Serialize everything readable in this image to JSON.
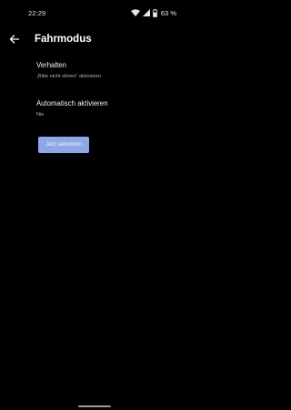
{
  "status_bar": {
    "time": "22:29",
    "battery": "63 %",
    "icons": [
      "wifi-icon",
      "signal-icon",
      "battery-icon"
    ]
  },
  "app_bar": {
    "title": "Fahrmodus",
    "back_icon": "arrow-back-icon"
  },
  "preferences": [
    {
      "title": "Verhalten",
      "summary": "„Bitte nicht stören“ aktivieren"
    },
    {
      "title": "Automatisch aktivieren",
      "summary": "Nie"
    }
  ],
  "activate_button": {
    "label": "Jetzt aktivieren",
    "color": "#8fa7e6"
  },
  "colors": {
    "background": "#000000",
    "accent": "#8fa7e6"
  }
}
